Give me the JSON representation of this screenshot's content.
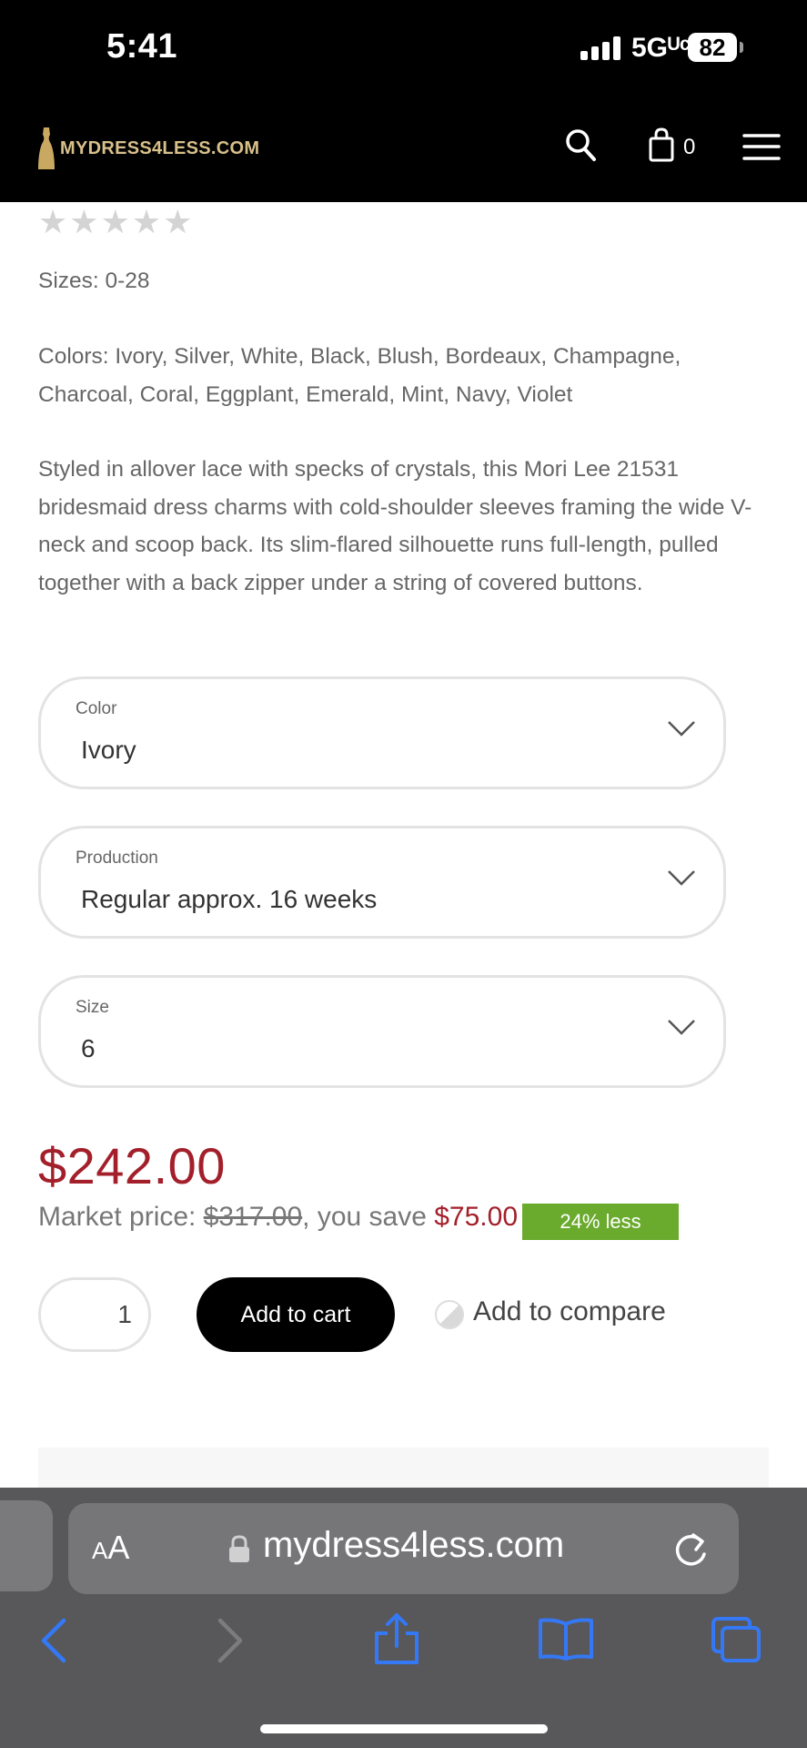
{
  "status_bar": {
    "time": "5:41",
    "network": "5Gᵁᶜ",
    "battery": "82"
  },
  "header": {
    "logo_text": "MYDRESS4LESS.COM",
    "cart_count": "0",
    "icons": [
      "search-icon",
      "shopping-bag-icon",
      "menu-icon"
    ]
  },
  "product": {
    "rating_stars_filled": 0,
    "rating_stars_total": 5,
    "sizes": "Sizes: 0-28",
    "colors": "Colors: Ivory, Silver, White, Black, Blush, Bordeaux, Champagne, Charcoal, Coral, Eggplant, Emerald, Mint, Navy, Violet",
    "description": "Styled in allover lace with specks of crystals, this Mori Lee 21531 bridesmaid dress charms with cold-shoulder sleeves framing the wide V-neck and scoop back. Its slim-flared silhouette runs full-length, pulled together with a back zipper under a string of covered buttons."
  },
  "options": {
    "color": {
      "label": "Color",
      "value": "Ivory"
    },
    "production": {
      "label": "Production",
      "value": "Regular approx. 16 weeks"
    },
    "size": {
      "label": "Size",
      "value": "6"
    }
  },
  "pricing": {
    "price": "$242.00",
    "market_label": "Market price: ",
    "market_price": "$317.00",
    "save_text": ", you save ",
    "save_amount": "$75.00",
    "discount_badge": "24% less"
  },
  "actions": {
    "quantity": "1",
    "add_to_cart": "Add to cart",
    "add_to_compare": "Add to compare"
  },
  "browser": {
    "text_size_label": "AA",
    "url": "mydress4less.com",
    "toolbar_icons": [
      "back-icon",
      "forward-icon",
      "share-icon",
      "bookmarks-icon",
      "tabs-icon"
    ]
  },
  "colors": {
    "price_red": "#a3202b",
    "badge_green": "#6aaa2d",
    "safari_blue": "#3478f6",
    "header_black": "#000000",
    "logo_gold": "#d8c08a"
  }
}
